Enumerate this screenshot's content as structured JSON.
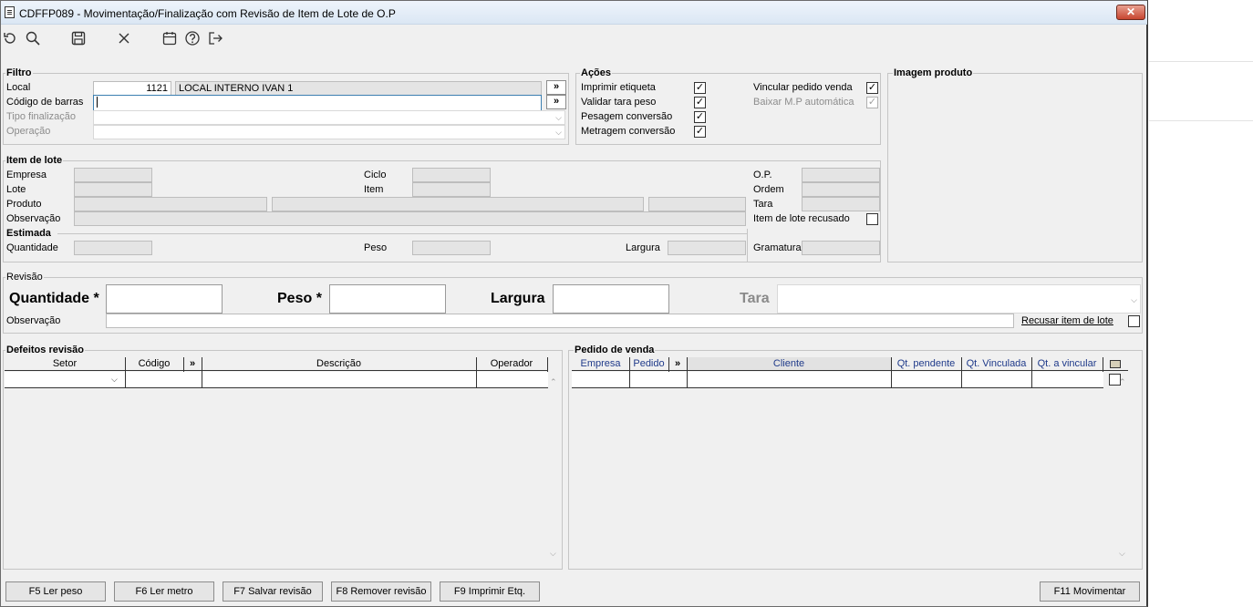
{
  "window": {
    "title": "CDFFP089 - Movimentação/Finalização com Revisão de Item de Lote de O.P",
    "close": "✕"
  },
  "toolbar": [
    "refresh-icon",
    "search-icon",
    "save-icon",
    "cancel-icon",
    "calendar-icon",
    "help-icon",
    "exit-icon"
  ],
  "filtro": {
    "title": "Filtro",
    "local_label": "Local",
    "local_code": "1121",
    "local_name": "LOCAL INTERNO IVAN 1",
    "barcode_label": "Código de barras",
    "barcode_value": "",
    "tipo_label": "Tipo finalização",
    "operacao_label": "Operação",
    "arrow": "»"
  },
  "acoes": {
    "title": "Ações",
    "imprimir": "Imprimir etiqueta",
    "validar": "Validar tara peso",
    "pesagem": "Pesagem conversão",
    "metragem": "Metragem conversão",
    "vincular": "Vincular pedido venda",
    "baixar": "Baixar M.P automática",
    "check": "✓"
  },
  "imagem": {
    "title": "Imagem produto"
  },
  "item_lote": {
    "title": "Item de lote",
    "empresa": "Empresa",
    "lote": "Lote",
    "produto": "Produto",
    "observacao": "Observação",
    "ciclo": "Ciclo",
    "item": "Item",
    "op": "O.P.",
    "ordem": "Ordem",
    "tara": "Tara",
    "recusado": "Item de lote recusado"
  },
  "estimada": {
    "title": "Estimada",
    "quantidade": "Quantidade",
    "peso": "Peso",
    "largura": "Largura",
    "gramatura": "Gramatura"
  },
  "revisao": {
    "title": "Revisão",
    "quantidade": "Quantidade *",
    "peso": "Peso *",
    "largura": "Largura",
    "tara": "Tara",
    "observacao": "Observação",
    "recusar": "Recusar item de lote"
  },
  "defeitos": {
    "title": "Defeitos revisão",
    "columns": [
      "Setor",
      "Código",
      "»",
      "Descrição",
      "Operador"
    ]
  },
  "pedido": {
    "title": "Pedido de venda",
    "columns": [
      "Empresa",
      "Pedido",
      "»",
      "Cliente",
      "Qt. pendente",
      "Qt. Vinculada",
      "Qt. a vincular"
    ]
  },
  "footer": {
    "f5": "F5 Ler peso",
    "f6": "F6 Ler metro",
    "f7": "F7 Salvar revisão",
    "f8": "F8 Remover revisão",
    "f9": "F9 Imprimir Etq.",
    "f11": "F11 Movimentar"
  }
}
